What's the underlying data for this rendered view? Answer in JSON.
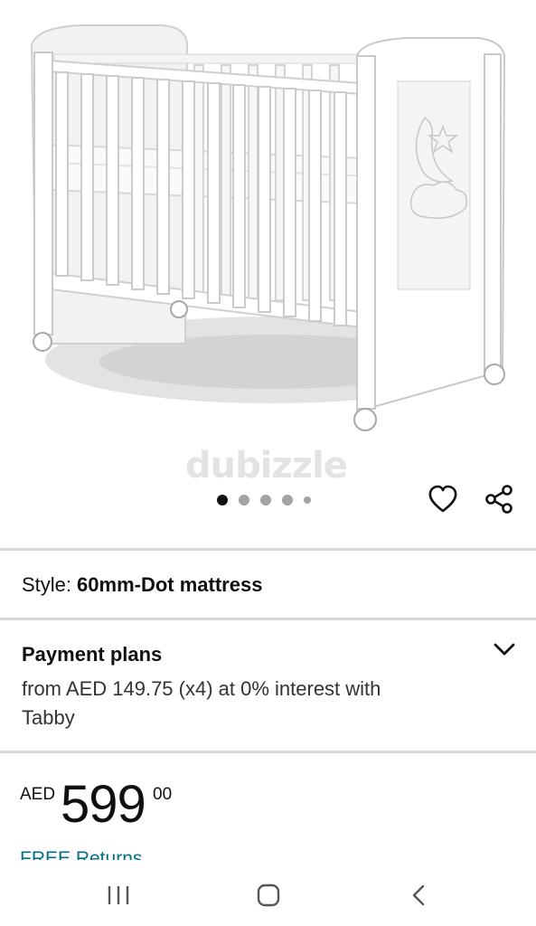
{
  "hero": {
    "watermark": "dubizzle",
    "image_alt": "white baby crib",
    "carousel": {
      "count": 5,
      "active_index": 0
    }
  },
  "actions": {
    "favorite_icon": "heart-icon",
    "share_icon": "share-icon"
  },
  "style": {
    "label": "Style:",
    "value": "60mm-Dot mattress"
  },
  "payment": {
    "title": "Payment plans",
    "description": "from AED 149.75 (x4) at 0% interest with Tabby",
    "chevron_icon": "chevron-down-icon"
  },
  "price": {
    "currency": "AED",
    "whole": "599",
    "fraction": "00"
  },
  "returns": {
    "label": "FREE Returns"
  },
  "system_nav": {
    "recents_icon": "recents-icon",
    "home_icon": "home-icon",
    "back_icon": "back-icon"
  },
  "colors": {
    "link": "#007185",
    "divider": "#d5d9d9",
    "text": "#0f1111"
  }
}
